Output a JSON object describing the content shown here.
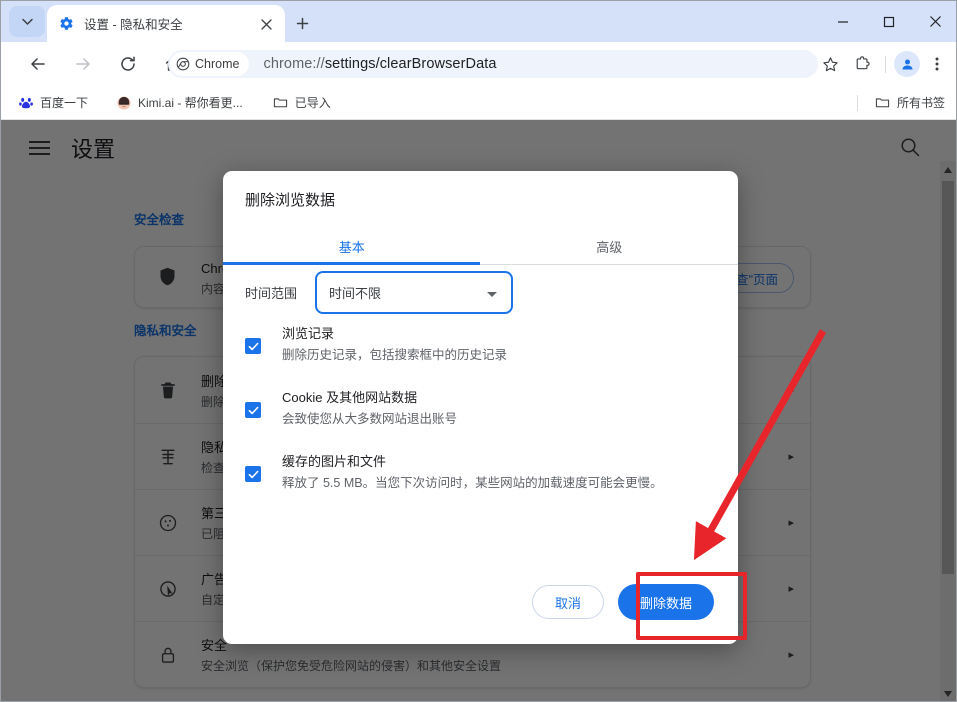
{
  "window": {
    "controls": {
      "minimize": "−",
      "maximize": "□",
      "close": "✕"
    }
  },
  "tabstrip": {
    "tab_search_icon": "chevron-down-icon",
    "tabs": [
      {
        "favicon": "settings-gear-icon",
        "title": "设置 - 隐私和安全",
        "close_label": "✕",
        "active": true
      }
    ],
    "new_tab_label": "+"
  },
  "toolbar": {
    "back_label": "←",
    "forward_label": "→",
    "reload_label": "⟳",
    "home_label": "⌂",
    "chrome_chip_label": "Chrome",
    "url_scheme": "chrome://",
    "url_path": "settings/clearBrowserData",
    "bookmark_star_label": "☆",
    "extensions_label": "extensions-puzzle-icon",
    "profile_label": "profile-avatar-icon",
    "menu_label": "⋮"
  },
  "bookmarks": {
    "items": [
      {
        "icon": "baidu-icon",
        "label": "百度一下"
      },
      {
        "icon": "kimi-avatar-icon",
        "label": "Kimi.ai - 帮你看更..."
      },
      {
        "icon": "folder-icon",
        "label": "已导入"
      }
    ],
    "all_bookmarks": {
      "icon": "folder-icon",
      "label": "所有书签"
    }
  },
  "settings_page": {
    "menu_label": "hamburger-menu-icon",
    "title": "设置",
    "search_label": "search-icon",
    "safety_check": {
      "section_label": "安全检查",
      "icon": "shield-icon",
      "title": "Chrome 安全检查",
      "subtitle": "内容需要您注意",
      "button_label": "转到\"安全检查\"页面"
    },
    "privacy": {
      "section_label": "隐私和安全",
      "rows": [
        {
          "icon": "trash-icon",
          "title": "删除浏览数据",
          "subtitle": "删除历史记录、Cookie、缓存及更多内容",
          "chevron": "▸"
        },
        {
          "icon": "privacy-guide-icon",
          "title": "隐私保护指南",
          "subtitle": "检查重要的隐私设置和安全设置",
          "chevron": "▸"
        },
        {
          "icon": "cookie-icon",
          "title": "第三方 Cookie",
          "subtitle": "已阻止第三方 Cookie",
          "chevron": "▸"
        },
        {
          "icon": "ad-privacy-icon",
          "title": "广告隐私设置",
          "subtitle": "自定义网站用于向您展示广告的信息",
          "chevron": "▸"
        },
        {
          "icon": "lock-icon",
          "title": "安全",
          "subtitle": "安全浏览（保护您免受危险网站的侵害）和其他安全设置",
          "chevron": "▸"
        }
      ]
    },
    "scrollbar": {
      "up_arrow": "▲",
      "down_arrow": "▼"
    }
  },
  "dialog": {
    "title": "删除浏览数据",
    "tabs": [
      {
        "label": "基本",
        "active": true
      },
      {
        "label": "高级",
        "active": false
      }
    ],
    "time_range": {
      "label": "时间范围",
      "value": "时间不限"
    },
    "checkboxes": [
      {
        "checked": true,
        "title": "浏览记录",
        "subtitle": "删除历史记录，包括搜索框中的历史记录"
      },
      {
        "checked": true,
        "title": "Cookie 及其他网站数据",
        "subtitle": "会致使您从大多数网站退出账号"
      },
      {
        "checked": true,
        "title": "缓存的图片和文件",
        "subtitle": "释放了 5.5 MB。当您下次访问时，某些网站的加载速度可能会更慢。"
      }
    ],
    "cancel_label": "取消",
    "confirm_label": "删除数据"
  },
  "annotations": {
    "highlight_color": "#e8252a",
    "arrow_color": "#e8252a",
    "target": "删除数据"
  },
  "colors": {
    "accent": "#1a73e8",
    "titlebar": "#d5e1f9",
    "omnibox": "#eff3fb"
  }
}
